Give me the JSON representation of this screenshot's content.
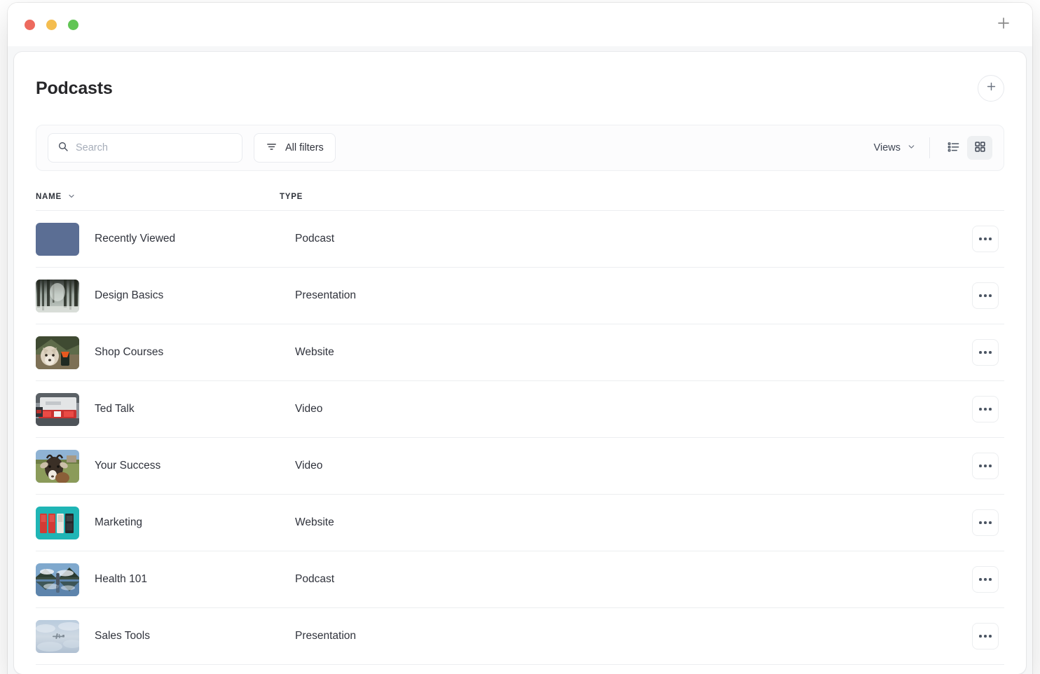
{
  "window": {
    "traffic_lights": [
      {
        "name": "close",
        "color": "#ed6a5e"
      },
      {
        "name": "minimize",
        "color": "#f4bd4f"
      },
      {
        "name": "maximize",
        "color": "#61c554"
      }
    ],
    "new_tab_icon": "plus-icon"
  },
  "header": {
    "title": "Podcasts",
    "add_icon": "plus-icon"
  },
  "toolbar": {
    "search": {
      "icon": "search-icon",
      "placeholder": "Search",
      "value": ""
    },
    "all_filters": {
      "label": "All filters",
      "icon": "filter-icon"
    },
    "views": {
      "label": "Views",
      "icon": "chevron-down-icon"
    },
    "view_modes": [
      {
        "name": "list-view",
        "icon": "list-icon",
        "active": false
      },
      {
        "name": "grid-view",
        "icon": "grid-icon",
        "active": true
      }
    ]
  },
  "table": {
    "columns": [
      {
        "key": "name",
        "label": "NAME",
        "sort_icon": "chevron-down-icon"
      },
      {
        "key": "type",
        "label": "TYPE"
      }
    ],
    "row_action_icon": "more-horizontal-icon",
    "rows": [
      {
        "name": "Recently Viewed",
        "type": "Podcast",
        "thumb": "solid-slate-blue"
      },
      {
        "name": "Design Basics",
        "type": "Presentation",
        "thumb": "snowy-forest"
      },
      {
        "name": "Shop Courses",
        "type": "Website",
        "thumb": "husky-dog"
      },
      {
        "name": "Ted Talk",
        "type": "Video",
        "thumb": "car-taillight"
      },
      {
        "name": "Your Success",
        "type": "Video",
        "thumb": "goat"
      },
      {
        "name": "Marketing",
        "type": "Website",
        "thumb": "memory-cards-teal"
      },
      {
        "name": "Health 101",
        "type": "Podcast",
        "thumb": "lake-reflection"
      },
      {
        "name": "Sales Tools",
        "type": "Presentation",
        "thumb": "airplane-sky"
      }
    ]
  },
  "colors": {
    "page_background": "#f6f7f8",
    "card_background": "#ffffff",
    "text_primary": "#30333c",
    "text_muted": "#a6adb9",
    "border": "#eceef0",
    "thumb_slate_blue": "#5b6e94",
    "thumb_teal": "#1fb5b5"
  }
}
